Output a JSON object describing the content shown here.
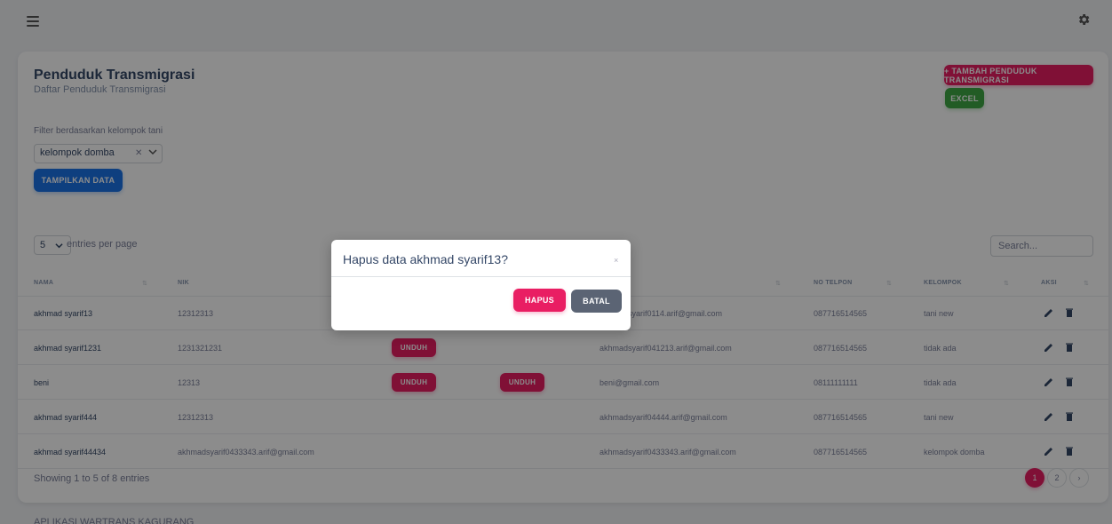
{
  "page": {
    "title": "Penduduk Transmigrasi",
    "subtitle": "Daftar Penduduk Transmigrasi",
    "add_button": "+ TAMBAH PENDUDUK TRANSMIGRASI",
    "excel_button": "EXCEL"
  },
  "filter": {
    "label": "Filter berdasarkan kelompok tani",
    "selected": "kelompok domba",
    "show_button": "TAMPILKAN DATA"
  },
  "table": {
    "entries_value": "5",
    "entries_label": "entries per page",
    "search_placeholder": "Search...",
    "headers": {
      "nama": "NAMA",
      "nik": "NIK",
      "no_telpon": "NO TELPON",
      "kelompok": "KELOMPOK",
      "aksi": "AKSI"
    },
    "unduh_label": "UNDUH",
    "rows": [
      {
        "nama": "akhmad syarif13",
        "nik": "12312313",
        "email": "akhmadsyarif0114.arif@gmail.com",
        "telpon": "087716514565",
        "kelompok": "tani new"
      },
      {
        "nama": "akhmad syarif1231",
        "nik": "1231321231",
        "email": "akhmadsyarif041213.arif@gmail.com",
        "telpon": "087716514565",
        "kelompok": "tidak ada"
      },
      {
        "nama": "beni",
        "nik": "12313",
        "email": "beni@gmail.com",
        "telpon": "08111111111",
        "kelompok": "tidak ada"
      },
      {
        "nama": "akhmad syarif444",
        "nik": "12312313",
        "email": "akhmadsyarif04444.arif@gmail.com",
        "telpon": "087716514565",
        "kelompok": "tani new"
      },
      {
        "nama": "akhmad syarif44434",
        "nik": "akhmadsyarif0433343.arif@gmail.com",
        "email": "akhmadsyarif0433343.arif@gmail.com",
        "telpon": "087716514565",
        "kelompok": "kelompok domba"
      }
    ],
    "showing": "Showing 1 to 5 of 8 entries",
    "pages": [
      "1",
      "2",
      "›"
    ]
  },
  "footer": {
    "text": "APLIKASI WARTRANS KAGURANG"
  },
  "modal": {
    "title": "Hapus data akhmad syarif13?",
    "close": "×",
    "confirm": "HAPUS",
    "cancel": "BATAL"
  },
  "colors": {
    "primary": "#e91e63",
    "success": "#3ea844",
    "info": "#1a73e8",
    "secondary": "#5b6474"
  },
  "icons": [
    "menu-icon",
    "gear-icon",
    "chevron-down-icon",
    "close-icon",
    "edit-icon",
    "trash-icon"
  ]
}
